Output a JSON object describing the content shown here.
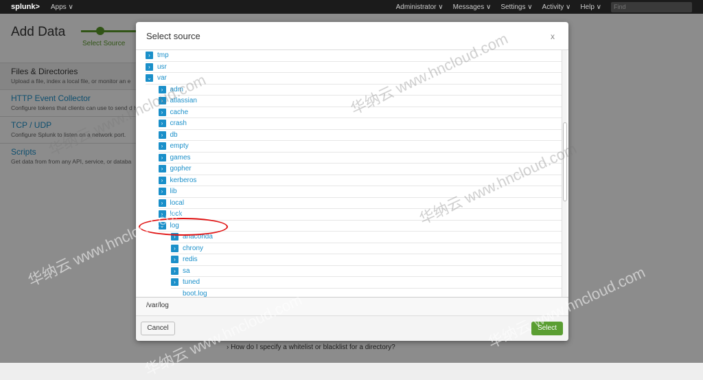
{
  "topbar": {
    "logo": "splunk>",
    "apps": "Apps ∨",
    "nav": [
      "Administrator ∨",
      "Messages ∨",
      "Settings ∨",
      "Activity ∨",
      "Help ∨"
    ],
    "find_placeholder": "Find"
  },
  "page": {
    "title": "Add Data",
    "step_label": "Select Source",
    "sources": [
      {
        "title": "Files & Directories",
        "desc": "Upload a file, index a local file, or monitor an e"
      },
      {
        "title": "HTTP Event Collector",
        "desc": "Configure tokens that clients can use to send d HTTPS."
      },
      {
        "title": "TCP / UDP",
        "desc": "Configure Splunk to listen on a network port."
      },
      {
        "title": "Scripts",
        "desc": "Get data from from any API, service, or databa"
      }
    ],
    "help_link": "How do I specify a whitelist or blacklist for a directory?"
  },
  "modal": {
    "title": "Select source",
    "close": "x",
    "selected_path": "/var/log",
    "cancel": "Cancel",
    "select": "Select",
    "tree": [
      {
        "name": "tmp",
        "level": 0,
        "state": "collapsed"
      },
      {
        "name": "usr",
        "level": 0,
        "state": "collapsed"
      },
      {
        "name": "var",
        "level": 0,
        "state": "expanded"
      },
      {
        "name": "adm",
        "level": 1,
        "state": "collapsed"
      },
      {
        "name": "atlassian",
        "level": 1,
        "state": "collapsed"
      },
      {
        "name": "cache",
        "level": 1,
        "state": "collapsed"
      },
      {
        "name": "crash",
        "level": 1,
        "state": "collapsed"
      },
      {
        "name": "db",
        "level": 1,
        "state": "collapsed"
      },
      {
        "name": "empty",
        "level": 1,
        "state": "collapsed"
      },
      {
        "name": "games",
        "level": 1,
        "state": "collapsed"
      },
      {
        "name": "gopher",
        "level": 1,
        "state": "collapsed"
      },
      {
        "name": "kerberos",
        "level": 1,
        "state": "collapsed"
      },
      {
        "name": "lib",
        "level": 1,
        "state": "collapsed"
      },
      {
        "name": "local",
        "level": 1,
        "state": "collapsed"
      },
      {
        "name": "lock",
        "level": 1,
        "state": "collapsed"
      },
      {
        "name": "log",
        "level": 1,
        "state": "expanded"
      },
      {
        "name": "anaconda",
        "level": 2,
        "state": "collapsed"
      },
      {
        "name": "chrony",
        "level": 2,
        "state": "collapsed"
      },
      {
        "name": "redis",
        "level": 2,
        "state": "collapsed"
      },
      {
        "name": "sa",
        "level": 2,
        "state": "collapsed"
      },
      {
        "name": "tuned",
        "level": 2,
        "state": "collapsed"
      },
      {
        "name": "boot.log",
        "level": 2,
        "state": "file"
      }
    ]
  },
  "watermark": "华纳云 www.hncloud.com",
  "colors": {
    "link": "#1a8fc9",
    "accent_green": "#5a9e32",
    "annotation": "#e01010"
  }
}
